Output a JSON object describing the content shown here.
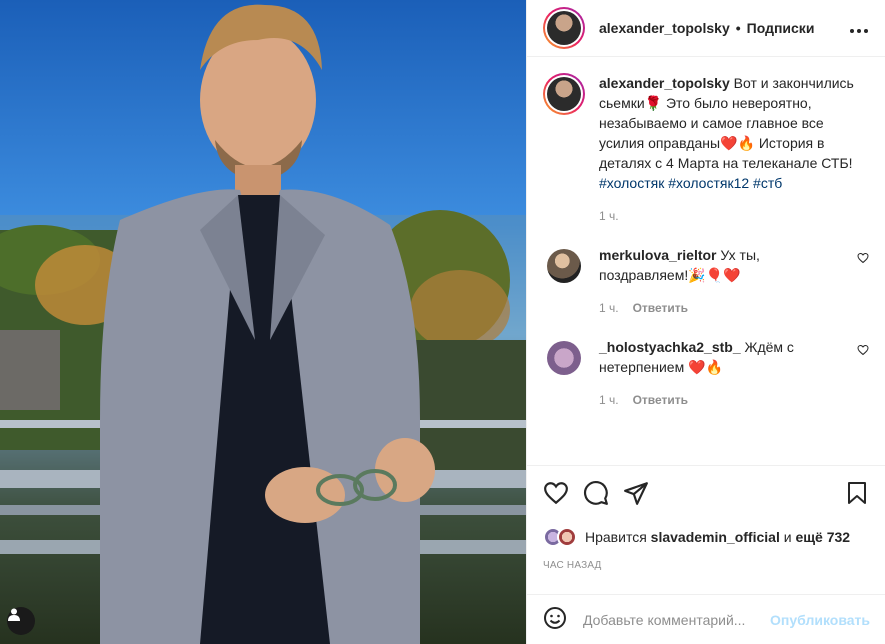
{
  "post": {
    "username": "alexander_topolsky",
    "dot": "•",
    "follow_label": "Подписки",
    "more_label": "•••",
    "caption": {
      "username": "alexander_topolsky",
      "text_1": "Вот и закончились сьемки🌹 Это было невероятно, незабываемо и самое главное все усилия оправданы❤️🔥 История в деталях с 4 Марта на телеканале СТБ!",
      "hashtags": "#холостяк #холостяк12 #стб",
      "time": "1 ч."
    },
    "comments": [
      {
        "username": "merkulova_rieltor",
        "text": "Ух ты, поздравляем!🎉🎈❤️",
        "time": "1 ч.",
        "reply_label": "Ответить"
      },
      {
        "username": "_holostyachka2_stb_",
        "text": "Ждём с нетерпением ❤️🔥",
        "time": "1 ч.",
        "reply_label": "Ответить"
      }
    ],
    "likes": {
      "prefix": "Нравится",
      "user": "slavademin_official",
      "middle": "и",
      "rest": "ещё 732"
    },
    "time_ago": "ЧАС НАЗАД",
    "add_comment": {
      "placeholder": "Добавьте комментарий...",
      "publish_label": "Опубликовать"
    }
  },
  "icons": [
    "user-tag-icon",
    "heart-icon",
    "comment-icon",
    "share-icon",
    "bookmark-icon",
    "emoji-icon",
    "more-icon"
  ],
  "colors": {
    "link": "#00376b",
    "muted": "#8e8e8e",
    "publish": "#b2dffc",
    "heart_red": "#ed4956"
  }
}
